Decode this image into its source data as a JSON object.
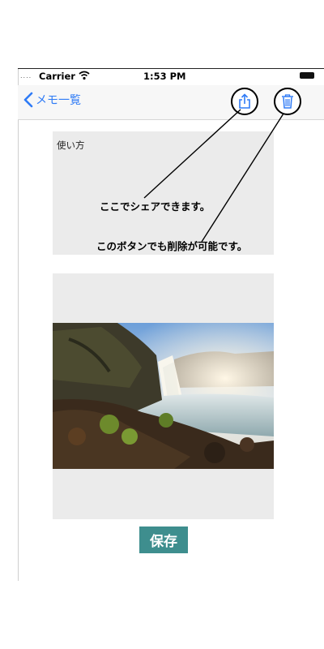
{
  "status_bar": {
    "carrier": "Carrier",
    "time": "1:53 PM",
    "signal": "....",
    "wifi_icon": "wifi-icon",
    "battery_icon": "battery-icon"
  },
  "nav": {
    "back_label": "メモ一覧",
    "share_icon": "share-icon",
    "trash_icon": "trash-icon",
    "accent_color": "#2f7bf6"
  },
  "memo": {
    "text": "使い方"
  },
  "annotations": {
    "share_note": "ここでシェアできます。",
    "delete_note": "このボタンでも削除が可能です。"
  },
  "image": {
    "icon": "waterfall-landscape-image"
  },
  "save_button": {
    "label": "保存",
    "color": "#3e8e8e"
  }
}
